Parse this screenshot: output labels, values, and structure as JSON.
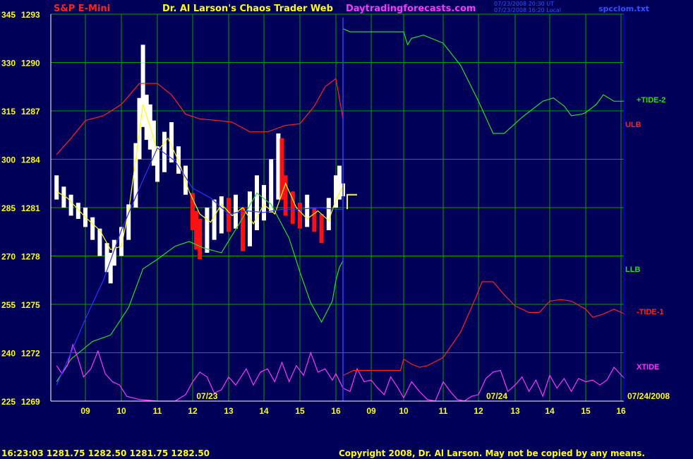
{
  "header": {
    "title_left": "S&P E-Mini",
    "title_center": "Dr. Al Larson's Chaos Trader Web",
    "title_site": "Daytradingforecasts.com",
    "stamp_line1": "07/23/2008 20:30 UT",
    "stamp_line2": "07/23/2008 16:20 Local",
    "file_name": "spcclom.txt"
  },
  "footer": {
    "quote": "16:23:03  1281.75  1282.50  1281.75  1282.50",
    "copyright": "Copyright 2008, Dr. Al Larson. May not be copied by any means."
  },
  "colors": {
    "background": "#000058",
    "grid": "#00a000",
    "frame": "#ffffff",
    "axis_text": "#ffff00",
    "title_red": "#ff2020",
    "title_yellow": "#ffff00",
    "site_magenta": "#ff33ff",
    "up_bars": "#ffffff",
    "down_bars": "#ff1010",
    "now_line": "#3040ff"
  },
  "chart_data": {
    "type": "line",
    "title": "S&P E-Mini",
    "y_left_ticks": [
      "345",
      "330",
      "315",
      "300",
      "285",
      "270",
      "255",
      "240",
      "225"
    ],
    "y_right_ticks": [
      "1293",
      "1290",
      "1287",
      "1284",
      "1281",
      "1278",
      "1275",
      "1272",
      "1269"
    ],
    "ylim_price": [
      1269,
      1293
    ],
    "x_ticks": [
      "09",
      "10",
      "11",
      "12",
      "13",
      "14",
      "15",
      "16",
      "09",
      "10",
      "11",
      "12",
      "13",
      "14",
      "15",
      "16"
    ],
    "xlim_hours": [
      8.2,
      24.1
    ],
    "date_labels": [
      {
        "text": "07/23",
        "hour": 12.4
      },
      {
        "text": "07/24",
        "hour": 20.5
      },
      {
        "text": "07/24/2008",
        "hour": 23.9
      }
    ],
    "grid": true,
    "now_hour": 16.2,
    "series": [
      {
        "name": "+TIDE-2",
        "color": "#22dd22",
        "points": [
          [
            16.2,
            1292.1
          ],
          [
            16.4,
            1291.9
          ],
          [
            18.0,
            1291.9
          ],
          [
            18.1,
            1291.1
          ],
          [
            18.2,
            1291.5
          ],
          [
            18.5,
            1291.7
          ],
          [
            19.0,
            1291.2
          ],
          [
            19.5,
            1289.8
          ],
          [
            20.0,
            1287.6
          ],
          [
            20.4,
            1285.6
          ],
          [
            20.7,
            1285.6
          ],
          [
            21.2,
            1286.6
          ],
          [
            21.8,
            1287.6
          ],
          [
            22.1,
            1287.8
          ],
          [
            22.4,
            1287.3
          ],
          [
            22.6,
            1286.7
          ],
          [
            22.9,
            1286.8
          ],
          [
            23.0,
            1286.9
          ],
          [
            23.3,
            1287.4
          ],
          [
            23.5,
            1288.0
          ],
          [
            23.8,
            1287.6
          ],
          [
            24.1,
            1287.6
          ]
        ]
      },
      {
        "name": "ULB",
        "color": "#ff2020",
        "points": [
          [
            8.2,
            1284.3
          ],
          [
            8.6,
            1285.3
          ],
          [
            9.0,
            1286.4
          ],
          [
            9.5,
            1286.7
          ],
          [
            10.0,
            1287.4
          ],
          [
            10.5,
            1288.7
          ],
          [
            11.0,
            1288.7
          ],
          [
            11.4,
            1288.0
          ],
          [
            11.8,
            1286.8
          ],
          [
            12.2,
            1286.5
          ],
          [
            12.7,
            1286.4
          ],
          [
            13.1,
            1286.3
          ],
          [
            13.6,
            1285.7
          ],
          [
            14.1,
            1285.7
          ],
          [
            14.6,
            1286.1
          ],
          [
            15.0,
            1286.2
          ],
          [
            15.4,
            1287.3
          ],
          [
            15.7,
            1288.5
          ],
          [
            16.0,
            1289.0
          ],
          [
            16.2,
            1286.5
          ]
        ]
      },
      {
        "name": "LLB",
        "color": "#22dd22",
        "points": [
          [
            8.2,
            1270.2
          ],
          [
            8.6,
            1271.6
          ],
          [
            9.2,
            1272.7
          ],
          [
            9.7,
            1273.1
          ],
          [
            10.2,
            1274.8
          ],
          [
            10.6,
            1277.2
          ],
          [
            11.0,
            1277.8
          ],
          [
            11.5,
            1278.6
          ],
          [
            11.9,
            1278.9
          ],
          [
            12.3,
            1278.5
          ],
          [
            12.8,
            1278.2
          ],
          [
            13.3,
            1280.0
          ],
          [
            13.8,
            1281.9
          ],
          [
            14.2,
            1281.2
          ],
          [
            14.7,
            1279.1
          ],
          [
            15.0,
            1277.0
          ],
          [
            15.3,
            1275.1
          ],
          [
            15.6,
            1273.9
          ],
          [
            15.9,
            1275.2
          ],
          [
            16.0,
            1276.5
          ],
          [
            16.1,
            1277.3
          ],
          [
            16.2,
            1277.7
          ]
        ]
      },
      {
        "name": "XTIDE",
        "color": "#ff33ff",
        "points": [
          [
            8.2,
            1271.2
          ],
          [
            8.35,
            1270.7
          ],
          [
            8.5,
            1271.2
          ],
          [
            8.65,
            1272.5
          ],
          [
            8.8,
            1271.6
          ],
          [
            8.95,
            1270.5
          ],
          [
            9.15,
            1271.0
          ],
          [
            9.35,
            1272.1
          ],
          [
            9.55,
            1270.7
          ],
          [
            9.75,
            1270.2
          ],
          [
            9.95,
            1270.0
          ],
          [
            10.15,
            1269.3
          ],
          [
            10.5,
            1269.1
          ],
          [
            11.0,
            1269.0
          ],
          [
            11.5,
            1269.0
          ],
          [
            11.8,
            1269.4
          ],
          [
            12.0,
            1270.2
          ],
          [
            12.2,
            1270.8
          ],
          [
            12.4,
            1270.5
          ],
          [
            12.6,
            1269.5
          ],
          [
            12.8,
            1269.7
          ],
          [
            13.0,
            1270.5
          ],
          [
            13.2,
            1270.0
          ],
          [
            13.5,
            1271.0
          ],
          [
            13.7,
            1270.0
          ],
          [
            13.9,
            1270.8
          ],
          [
            14.1,
            1271.0
          ],
          [
            14.3,
            1270.2
          ],
          [
            14.5,
            1271.4
          ],
          [
            14.7,
            1270.2
          ],
          [
            14.9,
            1271.2
          ],
          [
            15.1,
            1270.6
          ],
          [
            15.3,
            1272.0
          ],
          [
            15.5,
            1270.8
          ],
          [
            15.7,
            1271.0
          ],
          [
            15.9,
            1270.3
          ],
          [
            16.0,
            1270.7
          ],
          [
            16.2,
            1269.8
          ],
          [
            16.4,
            1269.6
          ],
          [
            16.6,
            1271.0
          ],
          [
            16.8,
            1270.2
          ],
          [
            17.0,
            1270.3
          ],
          [
            17.2,
            1269.8
          ],
          [
            17.4,
            1269.4
          ],
          [
            17.6,
            1270.5
          ],
          [
            17.8,
            1269.9
          ],
          [
            18.0,
            1269.2
          ],
          [
            18.2,
            1270.2
          ],
          [
            18.4,
            1269.6
          ],
          [
            18.6,
            1269.1
          ],
          [
            18.8,
            1269.0
          ],
          [
            19.0,
            1270.2
          ],
          [
            19.2,
            1269.6
          ],
          [
            19.4,
            1269.1
          ],
          [
            19.6,
            1269.0
          ],
          [
            19.8,
            1269.3
          ],
          [
            20.0,
            1269.4
          ],
          [
            20.2,
            1270.4
          ],
          [
            20.4,
            1270.8
          ],
          [
            20.6,
            1270.9
          ],
          [
            20.8,
            1269.6
          ],
          [
            21.0,
            1270.0
          ],
          [
            21.2,
            1270.5
          ],
          [
            21.4,
            1269.6
          ],
          [
            21.6,
            1270.3
          ],
          [
            21.8,
            1269.3
          ],
          [
            22.0,
            1270.6
          ],
          [
            22.2,
            1269.8
          ],
          [
            22.4,
            1270.4
          ],
          [
            22.6,
            1269.6
          ],
          [
            22.8,
            1270.4
          ],
          [
            23.0,
            1270.2
          ],
          [
            23.2,
            1270.3
          ],
          [
            23.4,
            1270.0
          ],
          [
            23.6,
            1270.3
          ],
          [
            23.8,
            1271.1
          ],
          [
            24.1,
            1270.4
          ]
        ]
      },
      {
        "name": "-TIDE-1",
        "color": "#ff2020",
        "points": [
          [
            16.2,
            1270.6
          ],
          [
            16.5,
            1270.9
          ],
          [
            17.0,
            1270.9
          ],
          [
            17.5,
            1270.9
          ],
          [
            17.9,
            1270.9
          ],
          [
            18.0,
            1271.6
          ],
          [
            18.2,
            1271.3
          ],
          [
            18.4,
            1271.1
          ],
          [
            18.6,
            1271.2
          ],
          [
            19.0,
            1271.7
          ],
          [
            19.5,
            1273.3
          ],
          [
            19.9,
            1275.3
          ],
          [
            20.1,
            1276.4
          ],
          [
            20.4,
            1276.4
          ],
          [
            20.7,
            1275.6
          ],
          [
            21.0,
            1274.9
          ],
          [
            21.4,
            1274.5
          ],
          [
            21.7,
            1274.5
          ],
          [
            22.0,
            1275.2
          ],
          [
            22.3,
            1275.3
          ],
          [
            22.6,
            1275.2
          ],
          [
            23.0,
            1274.7
          ],
          [
            23.2,
            1274.2
          ],
          [
            23.5,
            1274.4
          ],
          [
            23.8,
            1274.7
          ],
          [
            24.1,
            1274.4
          ]
        ]
      },
      {
        "name": "",
        "color": "#ffff00",
        "points": [
          [
            8.2,
            1282.0
          ],
          [
            8.5,
            1281.6
          ],
          [
            9.0,
            1280.4
          ],
          [
            9.4,
            1279.6
          ],
          [
            9.7,
            1278.4
          ],
          [
            10.0,
            1278.6
          ],
          [
            10.2,
            1280.8
          ],
          [
            10.4,
            1284.0
          ],
          [
            10.6,
            1287.4
          ],
          [
            10.8,
            1286.0
          ],
          [
            11.0,
            1284.5
          ],
          [
            11.3,
            1285.3
          ],
          [
            11.6,
            1283.9
          ],
          [
            11.9,
            1282.0
          ],
          [
            12.2,
            1280.6
          ],
          [
            12.5,
            1280.1
          ],
          [
            12.8,
            1281.2
          ],
          [
            13.1,
            1280.5
          ],
          [
            13.4,
            1281.0
          ],
          [
            13.7,
            1280.0
          ],
          [
            14.0,
            1281.2
          ],
          [
            14.3,
            1280.6
          ],
          [
            14.6,
            1282.5
          ],
          [
            14.9,
            1281.0
          ],
          [
            15.2,
            1280.3
          ],
          [
            15.5,
            1280.8
          ],
          [
            15.8,
            1280.2
          ],
          [
            16.0,
            1281.5
          ],
          [
            16.2,
            1282.3
          ]
        ]
      },
      {
        "name": "",
        "color": "#3030ff",
        "points": [
          [
            8.2,
            1270.0
          ],
          [
            8.6,
            1272.0
          ],
          [
            9.0,
            1274.1
          ],
          [
            9.5,
            1276.5
          ],
          [
            10.0,
            1279.6
          ],
          [
            10.5,
            1282.2
          ],
          [
            11.0,
            1284.7
          ],
          [
            11.5,
            1283.9
          ],
          [
            12.0,
            1282.2
          ],
          [
            12.5,
            1281.6
          ],
          [
            13.0,
            1280.6
          ],
          [
            13.5,
            1280.8
          ],
          [
            14.0,
            1280.7
          ],
          [
            14.5,
            1280.9
          ],
          [
            15.0,
            1280.9
          ],
          [
            15.5,
            1281.0
          ],
          [
            16.0,
            1280.9
          ],
          [
            16.2,
            1280.9
          ]
        ]
      }
    ],
    "price_bars_ohlc_approx": [
      [
        8.2,
        1281.5,
        1283.0
      ],
      [
        8.4,
        1281.0,
        1282.3
      ],
      [
        8.6,
        1280.5,
        1281.8
      ],
      [
        8.8,
        1280.3,
        1281.3
      ],
      [
        9.0,
        1279.8,
        1281.0
      ],
      [
        9.2,
        1279.0,
        1280.4
      ],
      [
        9.4,
        1278.0,
        1279.7
      ],
      [
        9.6,
        1277.0,
        1278.8
      ],
      [
        9.7,
        1276.3,
        1278.2
      ],
      [
        9.8,
        1277.4,
        1279.0
      ],
      [
        10.0,
        1278.0,
        1279.8
      ],
      [
        10.2,
        1279.0,
        1281.2
      ],
      [
        10.4,
        1281.0,
        1285.0
      ],
      [
        10.5,
        1284.0,
        1287.8
      ],
      [
        10.6,
        1286.0,
        1291.1
      ],
      [
        10.7,
        1285.2,
        1288.0
      ],
      [
        10.8,
        1284.6,
        1287.4
      ],
      [
        10.9,
        1283.6,
        1286.4
      ],
      [
        11.0,
        1282.6,
        1284.8
      ],
      [
        11.2,
        1283.2,
        1285.7
      ],
      [
        11.4,
        1283.8,
        1286.3
      ],
      [
        11.6,
        1283.1,
        1284.8
      ],
      [
        11.8,
        1281.8,
        1283.6
      ],
      [
        12.0,
        1279.6,
        1281.9
      ],
      [
        12.1,
        1278.4,
        1280.8
      ],
      [
        12.2,
        1277.8,
        1280.3
      ],
      [
        12.4,
        1278.2,
        1281.0
      ],
      [
        12.6,
        1279.0,
        1281.5
      ],
      [
        12.8,
        1279.4,
        1281.7
      ],
      [
        13.0,
        1279.5,
        1281.6
      ],
      [
        13.2,
        1279.7,
        1281.8
      ],
      [
        13.4,
        1278.3,
        1281.0
      ],
      [
        13.6,
        1278.6,
        1282.0
      ],
      [
        13.8,
        1279.6,
        1283.0
      ],
      [
        14.0,
        1280.2,
        1282.4
      ],
      [
        14.2,
        1280.7,
        1284.0
      ],
      [
        14.4,
        1281.5,
        1285.6
      ],
      [
        14.5,
        1281.5,
        1285.3
      ],
      [
        14.6,
        1280.5,
        1283.0
      ],
      [
        14.8,
        1280.0,
        1282.0
      ],
      [
        15.0,
        1279.7,
        1281.3
      ],
      [
        15.2,
        1279.8,
        1281.8
      ],
      [
        15.4,
        1279.5,
        1281.0
      ],
      [
        15.6,
        1278.8,
        1280.6
      ],
      [
        15.8,
        1279.6,
        1281.6
      ],
      [
        16.0,
        1281.0,
        1283.0
      ],
      [
        16.1,
        1281.5,
        1283.6
      ],
      [
        16.2,
        1281.7,
        1282.5
      ]
    ]
  },
  "labels": {
    "plus_tide2": "+TIDE-2",
    "ulb": "ULB",
    "llb": "LLB",
    "minus_tide1": "-TIDE-1",
    "xtide": "XTIDE"
  }
}
